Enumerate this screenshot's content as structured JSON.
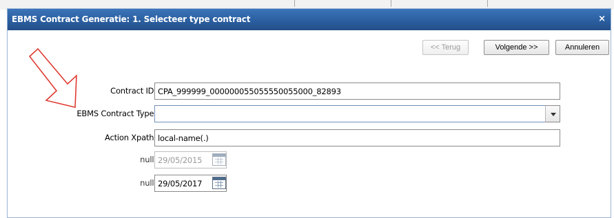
{
  "dialog": {
    "title": "EBMS Contract Generatie: 1. Selecteer type contract",
    "close_label": "×"
  },
  "toolbar": {
    "back_label": "<< Terug",
    "next_label": "Volgende >>",
    "cancel_label": "Annuleren"
  },
  "form": {
    "contract_id": {
      "label": "Contract ID:",
      "value": "CPA_999999_000000055055550055000_82893"
    },
    "contract_type": {
      "label": "EBMS Contract Type:",
      "value": ""
    },
    "action_xpath": {
      "label": "Action Xpath:",
      "value": "local-name(.)"
    },
    "date_start": {
      "label": "null:",
      "value": "29/05/2015"
    },
    "date_end": {
      "label": "null:",
      "value": "29/05/2017"
    }
  },
  "icons": {
    "dropdown": "chevron-down-icon",
    "calendar": "calendar-icon",
    "annotation": "red-arrow-annotation"
  },
  "colors": {
    "titlebar": "#2b5fa0",
    "annotation_arrow": "#e03a30"
  }
}
